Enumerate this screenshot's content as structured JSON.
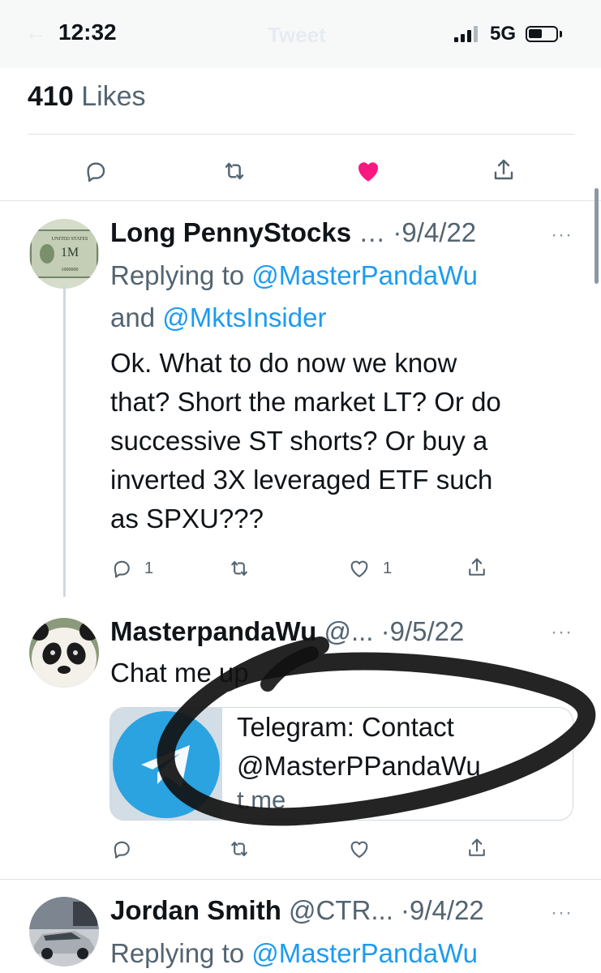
{
  "status_bar": {
    "time": "12:32",
    "network": "5G",
    "screen_title": "Tweet",
    "back_icon": "arrow-left-icon"
  },
  "focused_tweet": {
    "likes_count": "410",
    "likes_label": "Likes",
    "actions": [
      "reply-icon",
      "retweet-icon",
      "heart-filled-icon",
      "share-icon"
    ],
    "liked_color": "#f91880"
  },
  "replies": [
    {
      "name": "Long PennyStocks",
      "handle": "…",
      "separator": "·",
      "date": "9/4/22",
      "replying_prefix": "Replying to",
      "mention_1": "@MasterPandaWu",
      "conjunction": "and",
      "mention_2": "@MktsInsider",
      "text_lines": [
        "Ok. What to do now we know",
        "that? Short the market LT? Or do",
        "successive ST shorts? Or buy a",
        "inverted 3X leveraged ETF such",
        "as SPXU???"
      ],
      "reply_count": "1",
      "like_count": "1",
      "avatar": "million-dollar-bill-avatar"
    },
    {
      "name": "MasterpandaWu",
      "handle": "@...",
      "separator": "·",
      "date": "9/5/22",
      "text": "Chat me up",
      "card": {
        "title_line_1": "Telegram: Contact",
        "title_line_2": "@MasterPPandaWu",
        "domain": "t.me",
        "thumb_icon": "telegram-icon"
      },
      "avatar": "panda-avatar"
    },
    {
      "name": "Jordan Smith",
      "handle": "@CTR...",
      "separator": "·",
      "date": "9/4/22",
      "replying_prefix": "Replying to",
      "mention_1": "@MasterPandaWu",
      "avatar": "car-avatar"
    }
  ],
  "more_label": "···",
  "colors": {
    "accent": "#1d9bf0",
    "muted": "#536471",
    "text": "#0f1419",
    "divider": "#dfe3e6",
    "telegram": "#2aa3e0"
  }
}
